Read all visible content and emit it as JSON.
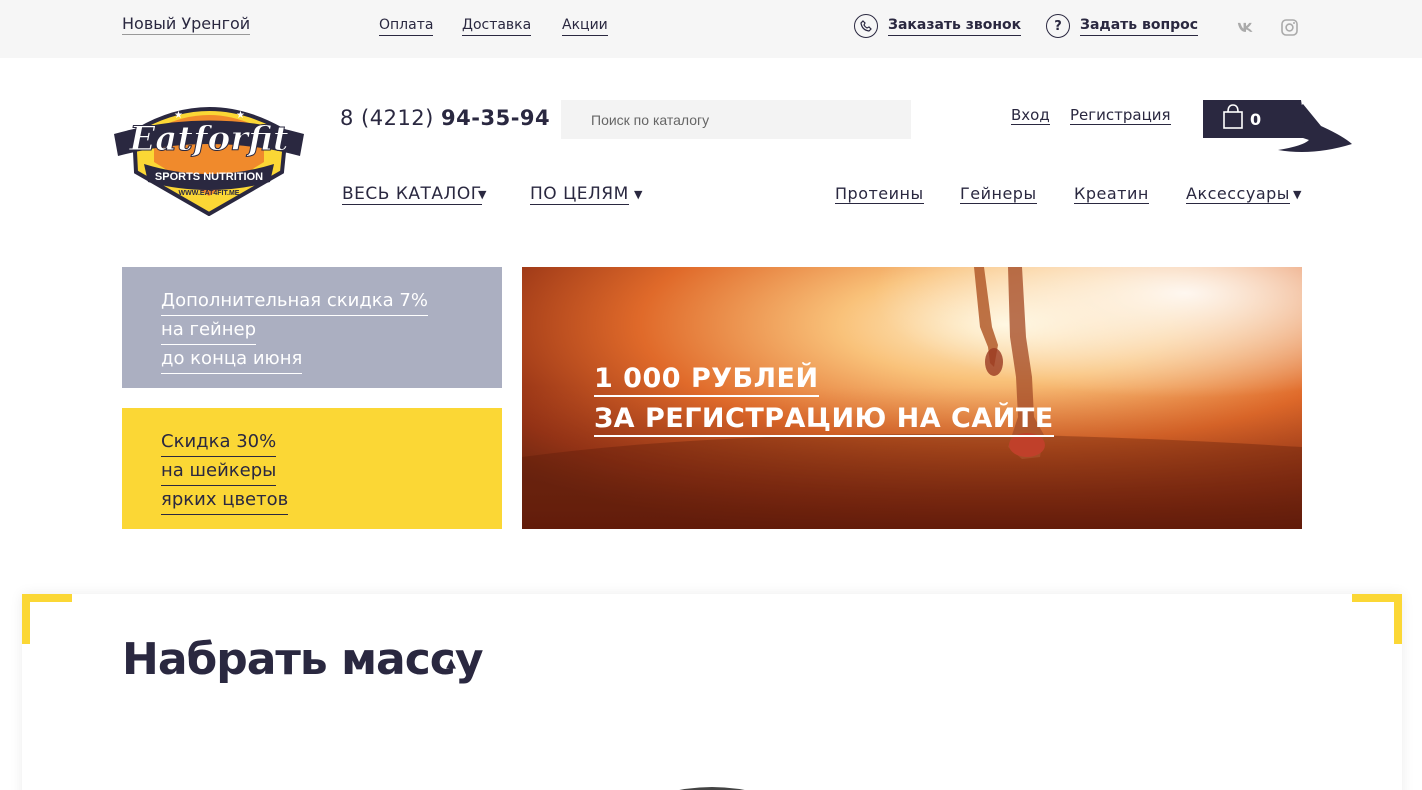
{
  "topbar": {
    "city": "Новый Уренгой",
    "links": [
      "Оплата",
      "Доставка",
      "Акции"
    ],
    "callback": "Заказать звонок",
    "question": "Задать вопрос",
    "question_icon": "?",
    "social": [
      "vk-icon",
      "instagram-icon"
    ]
  },
  "header": {
    "logo_alt": "Eatforfit Sports Nutrition www.eat4fit.me",
    "logo_text": "Eatforfit",
    "logo_sub": "SPORTS NUTRITION",
    "logo_url": "WWW.EAT4FIT.ME",
    "phone_prefix": "8 (4212) ",
    "phone_main": "94-35-94",
    "search_placeholder": "Поиск по каталогу",
    "login": "Вход",
    "register": "Регистрация",
    "cart_count": "0"
  },
  "nav": {
    "catalog": "ВЕСЬ КАТАЛОГ",
    "goals": "ПО ЦЕЛЯМ",
    "items": [
      "Протеины",
      "Гейнеры",
      "Креатин",
      "Аксессуары"
    ]
  },
  "promos": {
    "grey": [
      "Дополнительная скидка 7%",
      "на гейнер",
      "до конца июня"
    ],
    "yellow": [
      "Скидка 30%",
      "на шейкеры",
      "ярких цветов"
    ]
  },
  "hero": {
    "line1": "1 000 РУБЛЕЙ",
    "line2": "ЗА РЕГИСТРАЦИЮ НА САЙТЕ"
  },
  "section": {
    "title": "Набрать массу"
  },
  "colors": {
    "brand_dark": "#2a2840",
    "yellow": "#fbd735",
    "grey_promo": "#abafc1"
  }
}
